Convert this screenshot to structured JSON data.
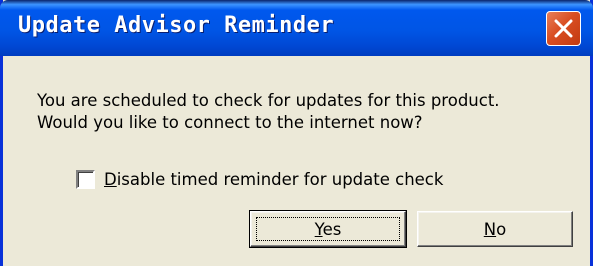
{
  "window": {
    "title": "Update Advisor Reminder"
  },
  "message": {
    "line1": "You are scheduled to check for updates for this product.",
    "line2": "Would you like to connect to the internet now?"
  },
  "checkbox": {
    "label_mnemonic": "D",
    "label_rest": "isable timed reminder for update check",
    "checked": false
  },
  "buttons": {
    "yes_mnemonic": "Y",
    "yes_rest": "es",
    "no_mnemonic": "N",
    "no_rest": "o"
  },
  "icons": {
    "close": "close-icon"
  },
  "colors": {
    "titlebar": "#0055e5",
    "close_button": "#d94e22",
    "dialog_background": "#ece9d8"
  }
}
